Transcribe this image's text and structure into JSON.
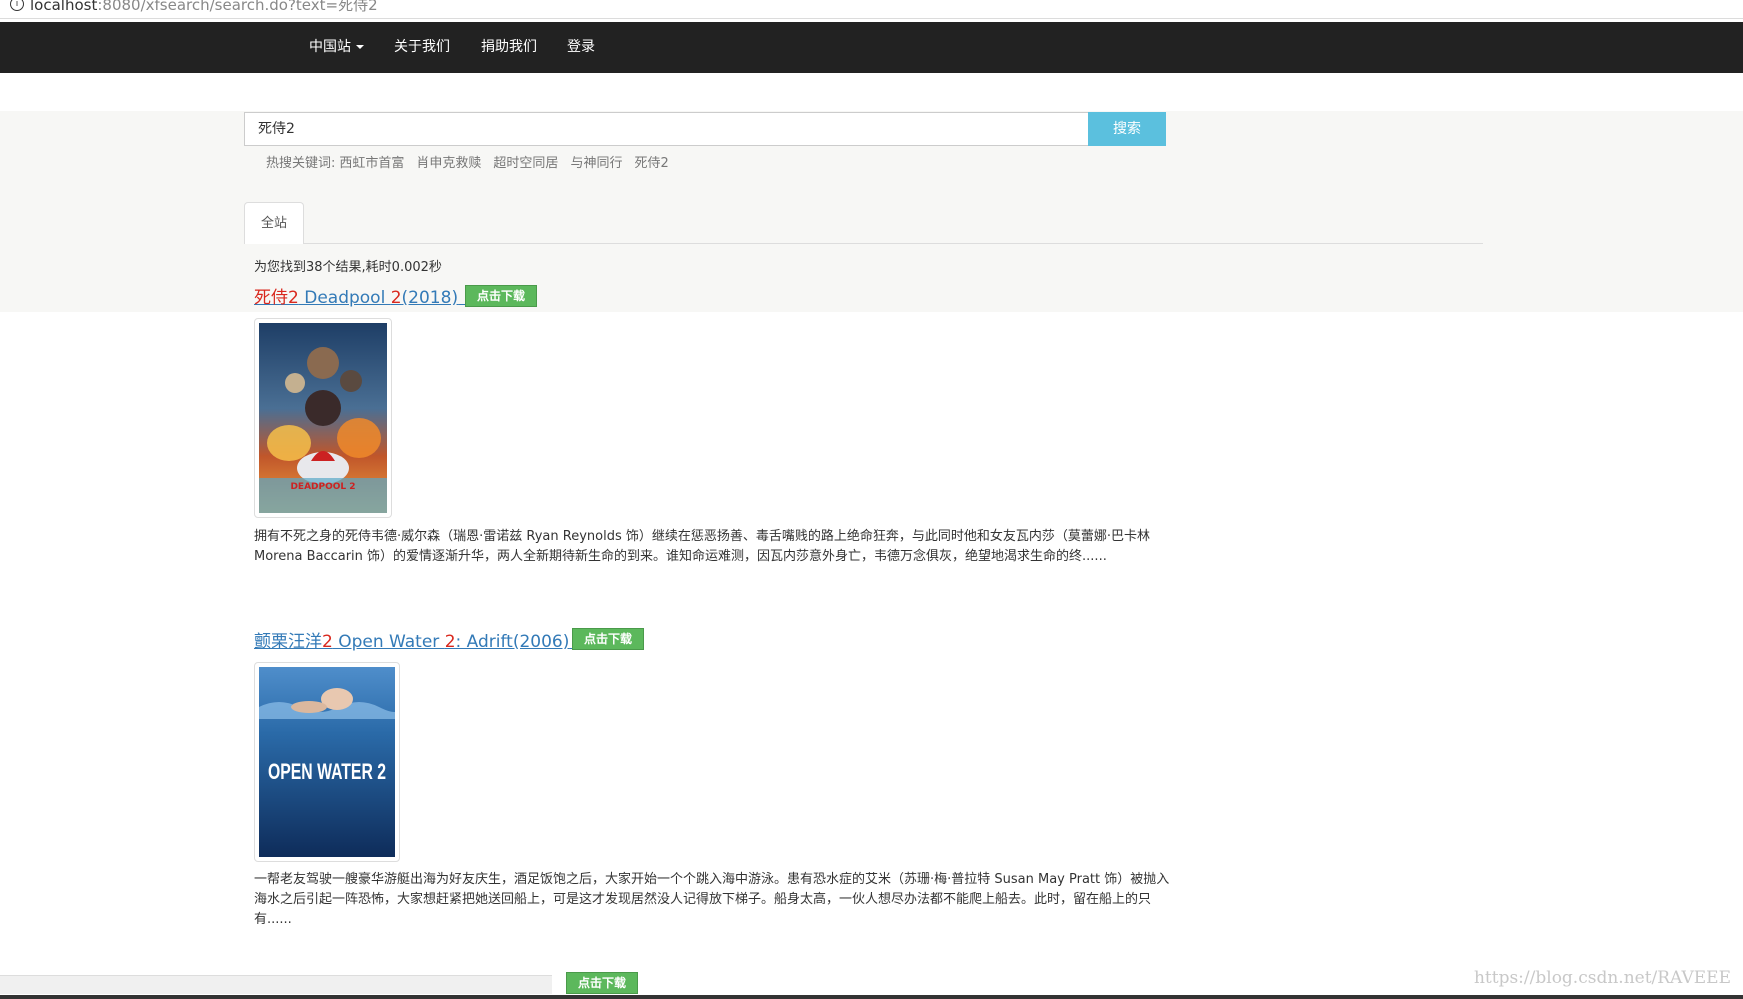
{
  "browser": {
    "url_host": "localhost",
    "url_rest": ":8080/xfsearch/search.do?text=死侍2"
  },
  "navbar": {
    "items": [
      {
        "label": "中国站"
      },
      {
        "label": "关于我们"
      },
      {
        "label": "捐助我们"
      },
      {
        "label": "登录"
      }
    ]
  },
  "search": {
    "value": "死侍2",
    "button_label": "搜索",
    "hot_prefix": "热搜关键词:",
    "hot_keywords": [
      "西虹市首富",
      "肖申克救赎",
      "超时空同居",
      "与神同行",
      "死侍2"
    ]
  },
  "tabs": [
    {
      "label": "全站"
    }
  ],
  "result_summary": "为您找到38个结果,耗时0.002秒",
  "results": [
    {
      "title_hl1": "死侍2",
      "title_mid": " Deadpool ",
      "title_hl2": "2",
      "title_end": "(2018)",
      "download_label": "点击下载",
      "poster_text": "DEADPOOL 2",
      "description": "拥有不死之身的死侍韦德·威尔森（瑞恩·雷诺兹 Ryan Reynolds 饰）继续在惩恶扬善、毒舌嘴贱的路上绝命狂奔，与此同时他和女友瓦内莎（莫蕾娜·巴卡林 Morena Baccarin 饰）的爱情逐渐升华，两人全新期待新生命的到来。谁知命运难测，因瓦内莎意外身亡，韦德万念俱灰，绝望地渴求生命的终......"
    },
    {
      "title_pre": "颤栗汪洋",
      "title_hl1": "2",
      "title_mid": " Open Water ",
      "title_hl2": "2",
      "title_end": ": Adrift(2006)",
      "download_label": "点击下载",
      "poster_text": "OPEN WATER 2",
      "description": "一帮老友驾驶一艘豪华游艇出海为好友庆生，酒足饭饱之后，大家开始一个个跳入海中游泳。患有恐水症的艾米（苏珊·梅·普拉特 Susan May Pratt 饰）被抛入海水之后引起一阵恐怖，大家想赶紧把她送回船上，可是这才发现居然没人记得放下梯子。船身太高，一伙人想尽办法都不能爬上船去。此时，留在船上的只有......"
    },
    {
      "download_label": "点击下载"
    }
  ],
  "watermark": "https://blog.csdn.net/RAVEEE"
}
